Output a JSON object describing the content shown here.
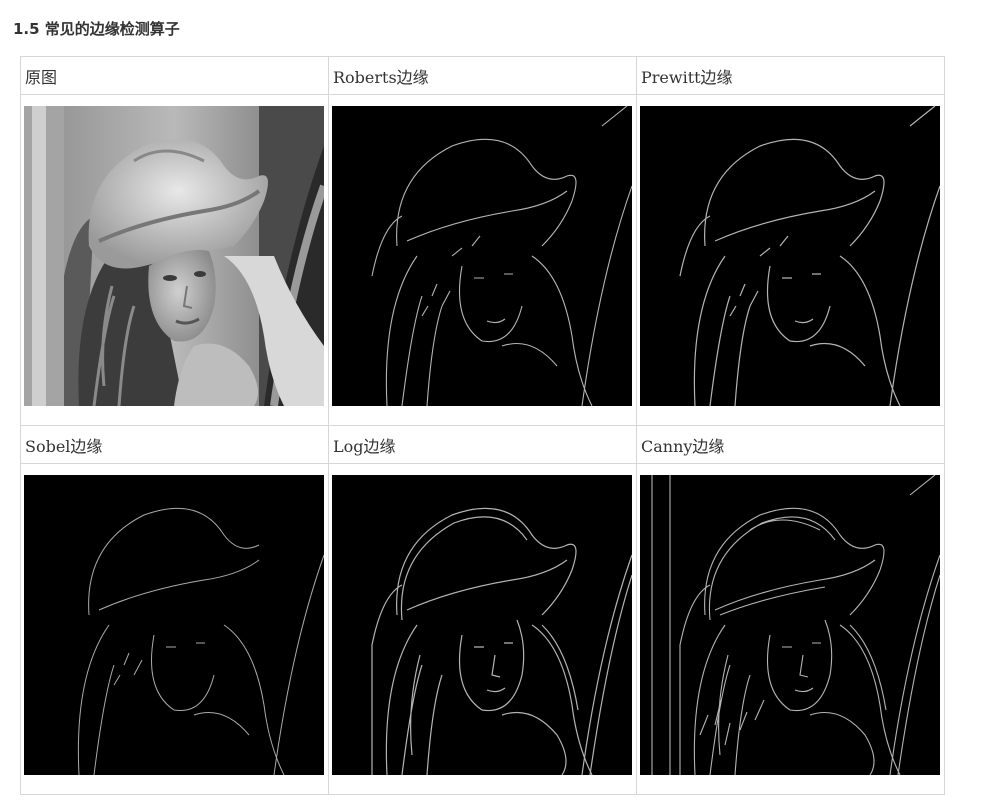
{
  "section": {
    "title": "1.5 常见的边缘检测算子"
  },
  "cells": [
    {
      "label": "原图",
      "image_kind": "original-grayscale-portrait"
    },
    {
      "label": "Roberts边缘",
      "image_kind": "edge-map"
    },
    {
      "label": "Prewitt边缘",
      "image_kind": "edge-map"
    },
    {
      "label": "Sobel边缘",
      "image_kind": "edge-map"
    },
    {
      "label": "Log边缘",
      "image_kind": "edge-map"
    },
    {
      "label": "Canny边缘",
      "image_kind": "edge-map"
    }
  ],
  "colors": {
    "title_text": "#333333",
    "cell_border": "#d6d6d6",
    "edge_background": "#000000",
    "edge_lines": "#b4b4b4"
  }
}
